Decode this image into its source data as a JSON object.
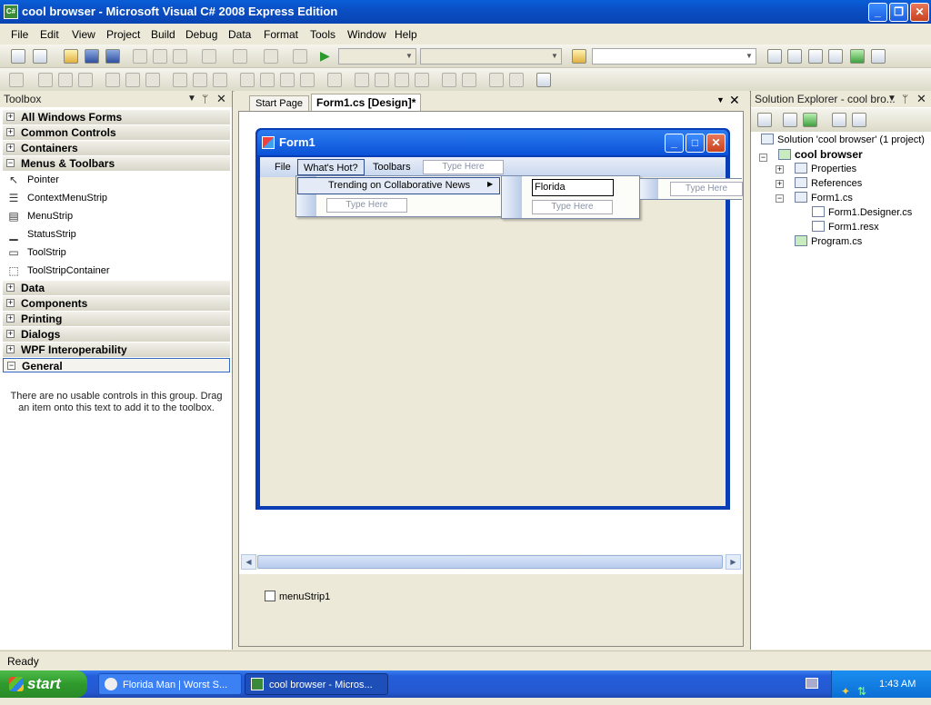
{
  "window": {
    "title": "cool browser - Microsoft Visual C# 2008 Express Edition",
    "app_icon_text": "C#"
  },
  "menubar": [
    "File",
    "Edit",
    "View",
    "Project",
    "Build",
    "Debug",
    "Data",
    "Format",
    "Tools",
    "Window",
    "Help"
  ],
  "toolbox": {
    "title": "Toolbox",
    "groups_top": [
      {
        "label": "All Windows Forms",
        "expanded": false
      },
      {
        "label": "Common Controls",
        "expanded": false
      },
      {
        "label": "Containers",
        "expanded": false
      },
      {
        "label": "Menus & Toolbars",
        "expanded": true
      }
    ],
    "items": [
      {
        "label": "Pointer",
        "icon": "pointer-icon"
      },
      {
        "label": "ContextMenuStrip",
        "icon": "context-menu-icon"
      },
      {
        "label": "MenuStrip",
        "icon": "menustrip-icon"
      },
      {
        "label": "StatusStrip",
        "icon": "statusstrip-icon"
      },
      {
        "label": "ToolStrip",
        "icon": "toolstrip-icon"
      },
      {
        "label": "ToolStripContainer",
        "icon": "toolstrip-container-icon"
      }
    ],
    "groups_bottom": [
      {
        "label": "Data",
        "expanded": false
      },
      {
        "label": "Components",
        "expanded": false
      },
      {
        "label": "Printing",
        "expanded": false
      },
      {
        "label": "Dialogs",
        "expanded": false
      },
      {
        "label": "WPF Interoperability",
        "expanded": false
      },
      {
        "label": "General",
        "expanded": true
      }
    ],
    "empty_message": "There are no usable controls in this group. Drag an item onto this text to add it to the toolbox."
  },
  "doc_tabs": [
    {
      "label": "Start Page",
      "active": false
    },
    {
      "label": "Form1.cs [Design]*",
      "active": true
    }
  ],
  "form": {
    "title": "Form1",
    "menu": {
      "items": [
        "File",
        "What's Hot?",
        "Toolbars"
      ],
      "type_here": "Type Here"
    },
    "submenu1": {
      "item": "Trending on Collaborative News",
      "type_here": "Type Here"
    },
    "submenu2": {
      "edit_value": "Florida",
      "type_here": "Type Here"
    },
    "submenu3": {
      "type_here": "Type Here"
    }
  },
  "component_tray": {
    "item": "menuStrip1"
  },
  "solution_explorer": {
    "title": "Solution Explorer - cool bro...",
    "solution": "Solution 'cool browser' (1 project)",
    "project": "cool browser",
    "nodes": [
      "Properties",
      "References",
      "Form1.cs",
      "Form1.Designer.cs",
      "Form1.resx",
      "Program.cs"
    ]
  },
  "status": {
    "text": "Ready"
  },
  "taskbar": {
    "start": "start",
    "tasks": [
      "Florida Man | Worst S...",
      "cool browser - Micros..."
    ],
    "clock": "1:43 AM"
  }
}
